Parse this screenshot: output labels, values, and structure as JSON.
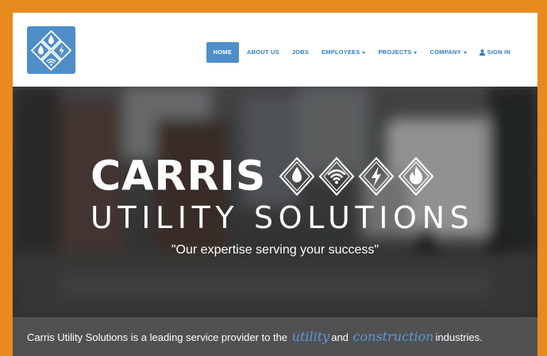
{
  "nav": {
    "items": [
      {
        "label": "HOME",
        "active": true
      },
      {
        "label": "ABOUT US"
      },
      {
        "label": "JOBS"
      },
      {
        "label": "EMPLOYEES",
        "dropdown": true
      },
      {
        "label": "PROJECTS",
        "dropdown": true
      },
      {
        "label": "COMPANY",
        "dropdown": true
      },
      {
        "label": "SIGN IN",
        "icon": "user-icon"
      }
    ]
  },
  "hero": {
    "brand_name": "CARRIS",
    "brand_sub": "UTILITY SOLUTIONS",
    "tagline": "\"Our expertise serving your success\"",
    "icons": [
      "water-drop-icon",
      "wifi-icon",
      "lightning-icon",
      "flame-icon"
    ]
  },
  "intro": {
    "prefix": "Carris Utility Solutions is a leading service provider to the",
    "word1": "utility",
    "middle": "and",
    "word2": "construction",
    "suffix": "industries."
  },
  "colors": {
    "frame": "#e88a1e",
    "accent": "#4f8ec9",
    "nav_text": "#2f7dc2",
    "intro_bg": "#515151",
    "script_text": "#5b9be0"
  }
}
